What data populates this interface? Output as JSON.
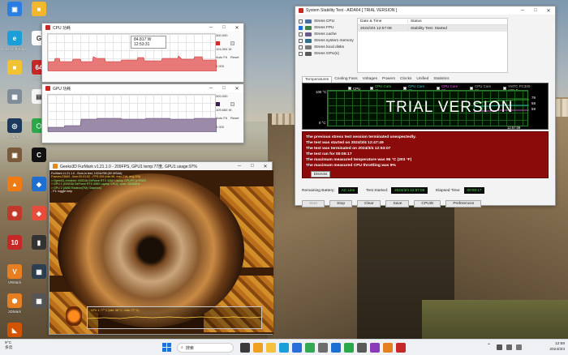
{
  "desktop": {
    "icons": [
      {
        "label": "",
        "color": "#2a7de1",
        "glyph": "▣"
      },
      {
        "label": "",
        "color": "#f1b82d",
        "glyph": "■"
      },
      {
        "label": "Microsoft Edge",
        "color": "#1a9fd8",
        "glyph": "e"
      },
      {
        "label": "",
        "color": "#ffffff",
        "glyph": "G"
      },
      {
        "label": "",
        "color": "#f1c232",
        "glyph": "■"
      },
      {
        "label": "AIDA64",
        "color": "#c62828",
        "glyph": "64"
      },
      {
        "label": "",
        "color": "#7f8c99",
        "glyph": "▦"
      },
      {
        "label": "",
        "color": "#f4f4f4",
        "glyph": "▤"
      },
      {
        "label": "Steam",
        "color": "#1b3a5c",
        "glyph": "◎"
      },
      {
        "label": "",
        "color": "#2aa84a",
        "glyph": "⬡"
      },
      {
        "label": "",
        "color": "#7a5a3a",
        "glyph": "▣"
      },
      {
        "label": "",
        "color": "#111111",
        "glyph": "C"
      },
      {
        "label": "",
        "color": "#f07b14",
        "glyph": "▲"
      },
      {
        "label": "",
        "color": "#1d6fd1",
        "glyph": "◆"
      },
      {
        "label": "",
        "color": "#c0392b",
        "glyph": "◉"
      },
      {
        "label": "",
        "color": "#e74c3c",
        "glyph": "◈"
      },
      {
        "label": "",
        "color": "#c62828",
        "glyph": "10"
      },
      {
        "label": "",
        "color": "#333333",
        "glyph": "▮"
      },
      {
        "label": "VRMark",
        "color": "#e67e22",
        "glyph": "V"
      },
      {
        "label": "",
        "color": "#2c3e50",
        "glyph": "▦"
      },
      {
        "label": "3DMark",
        "color": "#e67e22",
        "glyph": "⬢"
      },
      {
        "label": "",
        "color": "#555555",
        "glyph": "▦"
      },
      {
        "label": "",
        "color": "#d35400",
        "glyph": "◣"
      }
    ]
  },
  "cpu_window": {
    "title": "CPU 功耗",
    "tooltip_value": "84.817 W",
    "tooltip_time": "12:53:31",
    "scale_top": "300.000",
    "current_value": "104.394 W",
    "scale_bottom": "0.000",
    "auto_fit": "Auto Fit",
    "reset": "Reset"
  },
  "gpu_window": {
    "title": "GPU 功耗",
    "scale_top": "300.000",
    "current_value": "109.665 W",
    "scale_bottom": "0.000",
    "auto_fit": "Auto Fit",
    "reset": "Reset"
  },
  "stability": {
    "title": "System Stability Test - AIDA64 [ TRIAL VERSION ]",
    "stress_items": [
      {
        "label": "Stress CPU",
        "checked": false
      },
      {
        "label": "Stress FPU",
        "checked": true
      },
      {
        "label": "Stress cache",
        "checked": false
      },
      {
        "label": "Stress system memory",
        "checked": false
      },
      {
        "label": "Stress local disks",
        "checked": false
      },
      {
        "label": "Stress GPU(s)",
        "checked": false
      }
    ],
    "table": {
      "col_datetime": "Date & Time",
      "col_status": "Status",
      "rows": [
        {
          "datetime": "2024/3/4 12:57:08",
          "status": "Stability Test: Started"
        }
      ]
    },
    "tabs": [
      "Temperatures",
      "Cooling Fans",
      "Voltages",
      "Powers",
      "Clocks",
      "Unified",
      "Statistics"
    ],
    "legend": [
      "CPU",
      "CPU Core #1",
      "CPU Core #2",
      "CPU Core #3",
      "CPU Core #4",
      "YMTC PC300-1TB-B"
    ],
    "legend_colors": [
      "#ffffff",
      "#4dd44d",
      "#33d6d6",
      "#ff55ff",
      "#bbbbbb",
      "#bbbbbb"
    ],
    "y_top": "100 °C",
    "y_bottom": "0 °C",
    "right_vals": [
      "79",
      "58",
      "59"
    ],
    "time_label": "12:57:08",
    "trial_text": "TRIAL VERSION",
    "alert_lines": [
      "The previous stress test session terminated unexpectedly.",
      "The test was started on 2024/3/4 12:47:49",
      "The test was terminated on 2024/3/4 12:53:07",
      "The test ran for 00:05:17",
      "The maximum measured temperature was 95 °C  (203 °F)",
      "The maximum measured CPU throttling was 9%"
    ],
    "dismiss": "Dismiss",
    "remaining_battery_label": "Remaining Battery:",
    "remaining_battery_value": "AC Line",
    "test_started_label": "Test Started:",
    "test_started_value": "2024/3/4 12:57:08",
    "elapsed_label": "Elapsed Time:",
    "elapsed_value": "00:00:17",
    "buttons": [
      "Start",
      "Stop",
      "Clear",
      "Save",
      "CPUID",
      "Preferences"
    ]
  },
  "furmark": {
    "title": "Geeks3D FurMark v1.21.1.0 - 209FPS, GPU1 temp:77度, GPU1 usage:97%",
    "info_lines": [
      "FurMark v1.21.1.0 - Burn-in test, 1024x768 (8X MSAA)",
      "Frames:23669 - time:00:01:52 - FPS:209 (min:96, max:216, avg:209)",
      "> OpenGL renderer: NVIDIA GeForce RTX 4060 Laptop GPU/PCIe/SSE2",
      "> GPU 1 (NVIDIA GeForce RTX 4060 Laptop GPU) - core: 2520MHz",
      "> GPU 2 (AMD Radeon(TM) Graphics)",
      "- F1: toggle help"
    ],
    "strip_text": "GPU 1: 77° C (min: 46° C - max: 77° C)"
  },
  "taskbar": {
    "weather_temp": "9°C",
    "weather_desc": "多云",
    "search_placeholder": "搜索",
    "time": "12:58",
    "date": "2024/3/4"
  }
}
